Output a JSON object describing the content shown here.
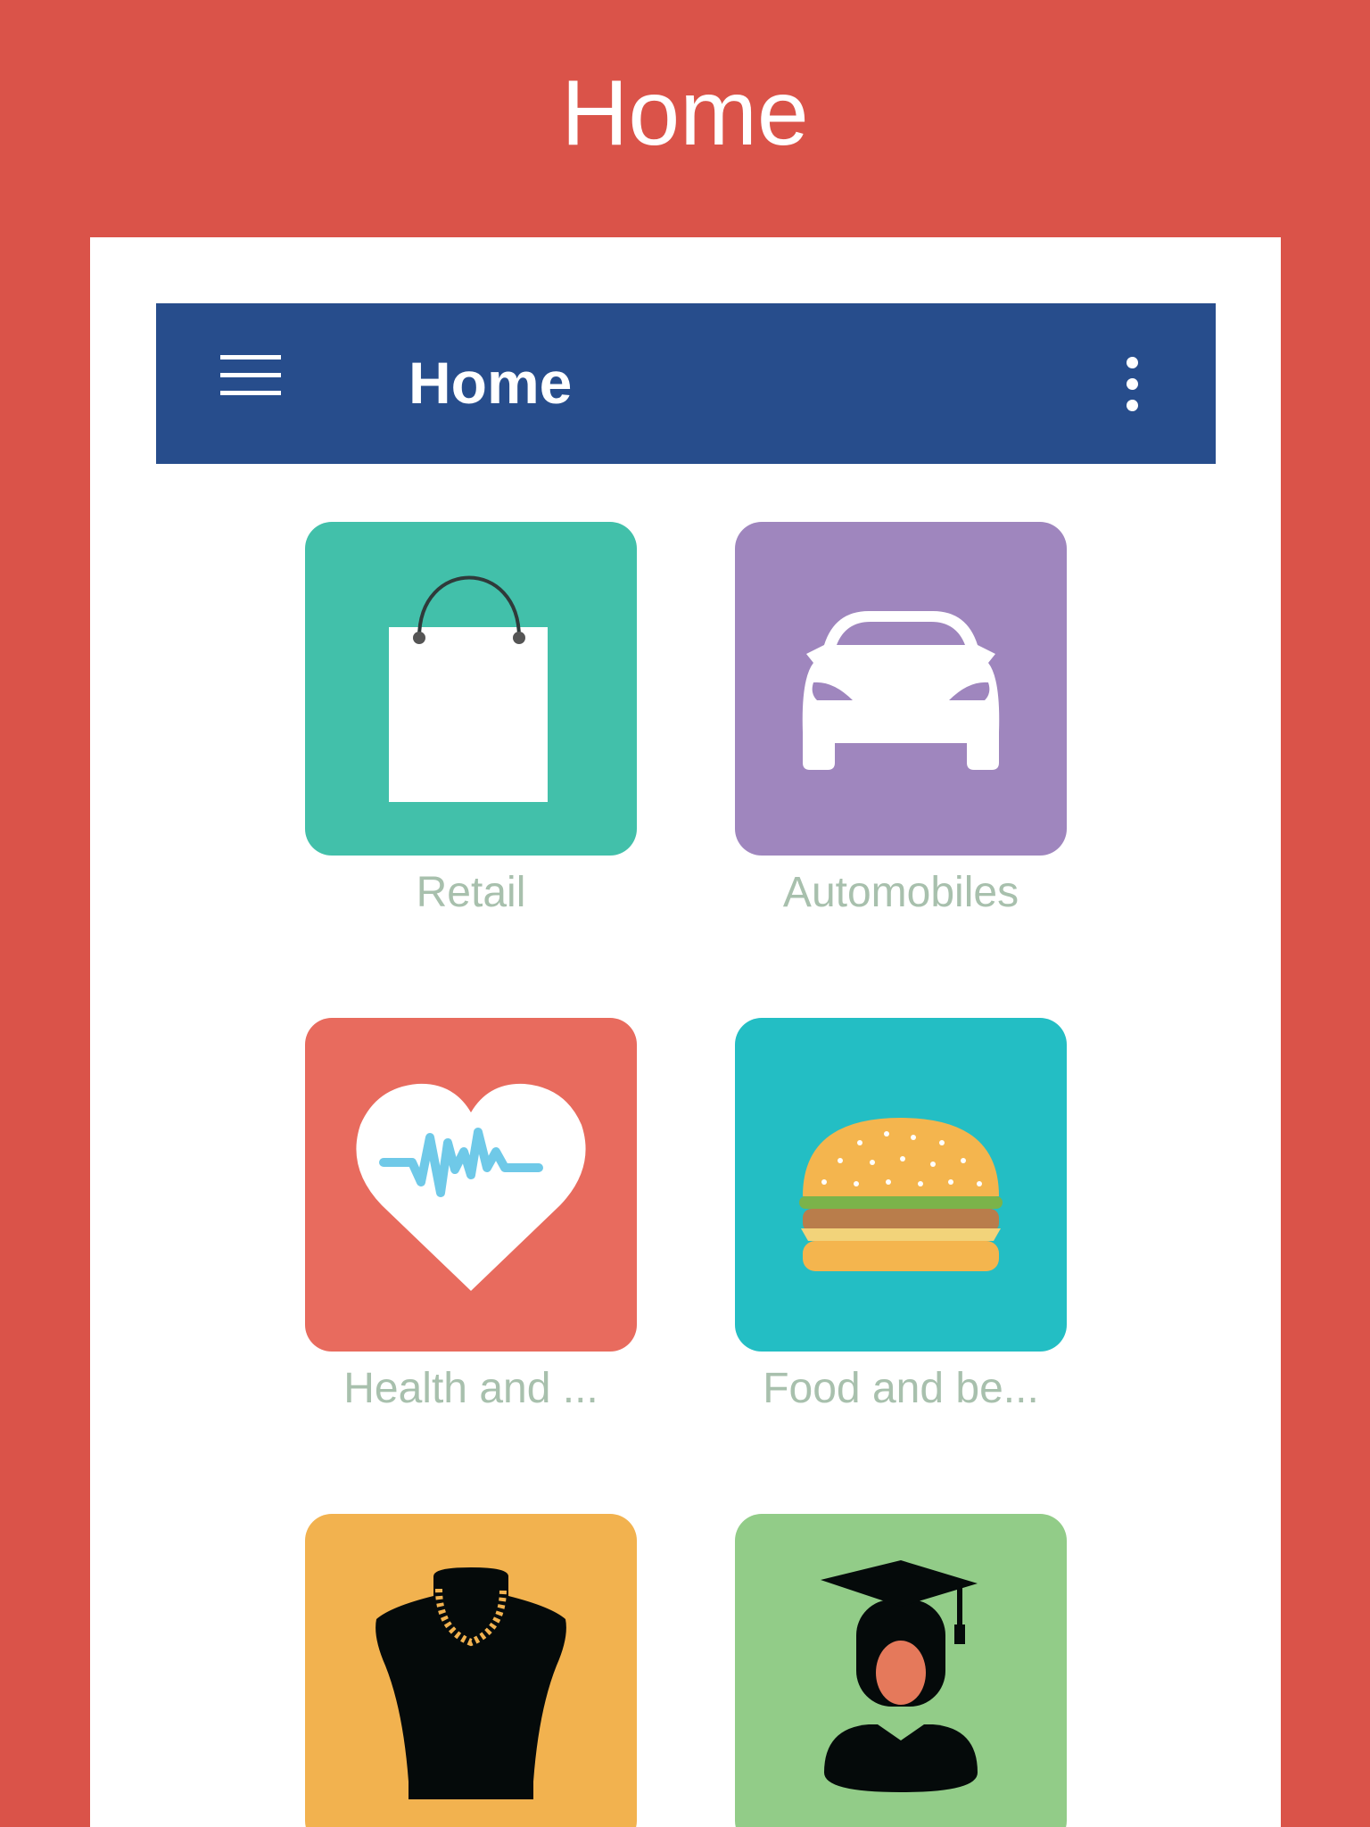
{
  "page": {
    "title": "Home"
  },
  "appbar": {
    "title": "Home"
  },
  "categories": [
    {
      "label": "Retail",
      "icon": "shopping-bag-icon",
      "color": "#42c0aa"
    },
    {
      "label": "Automobiles",
      "icon": "car-icon",
      "color": "#9f86be"
    },
    {
      "label": "Health and ...",
      "icon": "heart-pulse-icon",
      "color": "#e86b5e"
    },
    {
      "label": "Food and be...",
      "icon": "burger-icon",
      "color": "#23bec4"
    },
    {
      "label": "",
      "icon": "necklace-icon",
      "color": "#f2b24f"
    },
    {
      "label": "",
      "icon": "graduate-icon",
      "color": "#92cc88"
    }
  ],
  "colors": {
    "background": "#da5349",
    "appbar": "#274d8c",
    "label": "#a8c0ad"
  }
}
